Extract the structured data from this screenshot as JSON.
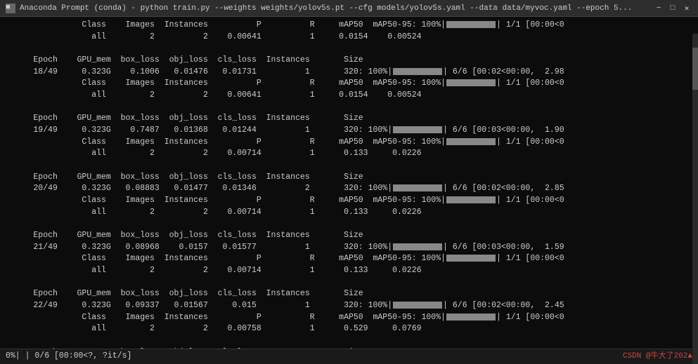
{
  "titleBar": {
    "title": "Anaconda Prompt (conda) - python  train.py --weights weights/yolov5s.pt  --cfg models/yolov5s.yaml  --data data/myvoc.yaml --epoch 5...",
    "icon": "terminal-icon",
    "minimizeLabel": "−",
    "maximizeLabel": "□",
    "closeLabel": "✕"
  },
  "terminal": {
    "lines": [
      "                Class    Images  Instances          P          R     mAP50  mAP50-95: 100%|                    | 1/1 [00:00<0",
      "                  all         2          2    0.00641          1     0.0154    0.00524",
      "",
      "      Epoch    GPU_mem  box_loss  obj_loss  cls_loss  Instances       Size",
      "      18/49     0.323G    0.1006   0.01476   0.01731          1       320: 100%|          | 6/6 [00:02<00:00,  2.98",
      "                Class    Images  Instances          P          R     mAP50  mAP50-95: 100%|                    | 1/1 [00:00<0",
      "                  all         2          2    0.00641          1     0.0154    0.00524",
      "",
      "      Epoch    GPU_mem  box_loss  obj_loss  cls_loss  Instances       Size",
      "      19/49     0.323G    0.7487   0.01368   0.01244          1       320: 100%|          | 6/6 [00:03<00:00,  1.90",
      "                Class    Images  Instances          P          R     mAP50  mAP50-95: 100%|                    | 1/1 [00:00<0",
      "                  all         2          2    0.00714          1      0.133     0.0226",
      "",
      "      Epoch    GPU_mem  box_loss  obj_loss  cls_loss  Instances       Size",
      "      20/49     0.323G   0.08883   0.01477   0.01346          2       320: 100%|          | 6/6 [00:02<00:00,  2.85",
      "                Class    Images  Instances          P          R     mAP50  mAP50-95: 100%|                    | 1/1 [00:00<0",
      "                  all         2          2    0.00714          1      0.133     0.0226",
      "",
      "      Epoch    GPU_mem  box_loss  obj_loss  cls_loss  Instances       Size",
      "      21/49     0.323G   0.08968    0.0157   0.01577          1       320: 100%|          | 6/6 [00:03<00:00,  1.59",
      "                Class    Images  Instances          P          R     mAP50  mAP50-95: 100%|                    | 1/1 [00:00<0",
      "                  all         2          2    0.00714          1      0.133     0.0226",
      "",
      "      Epoch    GPU_mem  box_loss  obj_loss  cls_loss  Instances       Size",
      "      22/49     0.323G   0.09337   0.01567     0.015          1       320: 100%|          | 6/6 [00:02<00:00,  2.45",
      "                Class    Images  Instances          P          R     mAP50  mAP50-95: 100%|                    | 1/1 [00:00<0",
      "                  all         2          2    0.00758          1      0.529     0.0769",
      "",
      "      Epoch    GPU_mem  box_loss  obj_loss  cls_loss  Instances       Size"
    ]
  },
  "bottomBar": {
    "progressText": "0%|          | 0/6 [00:00<?, ?it/s]",
    "watermark": "CSDN @牛大了202▲"
  }
}
